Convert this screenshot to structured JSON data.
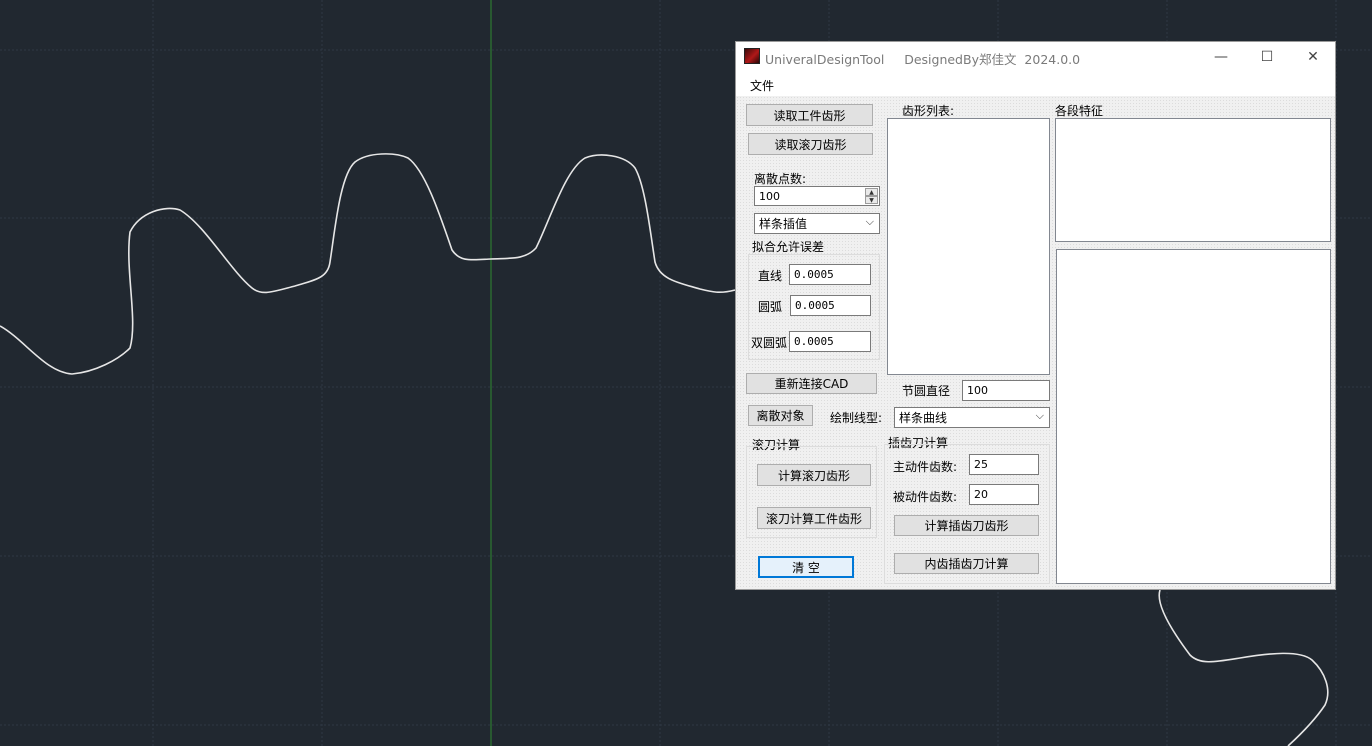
{
  "window": {
    "title": "UniveralDesignTool     DesignedBy郑佳文  2024.0.0",
    "minimize_glyph": "—",
    "maximize_glyph": "☐",
    "close_glyph": "✕"
  },
  "menu": {
    "file": "文件"
  },
  "left": {
    "read_workpiece_btn": "读取工件齿形",
    "read_hob_btn": "读取滚刀齿形",
    "discrete_points_label": "离散点数:",
    "discrete_points_value": "100",
    "interp_select": "样条插值",
    "fit_tolerance_title": "拟合允许误差",
    "line_label": "直线",
    "line_value": "0.0005",
    "arc_label": "圆弧",
    "arc_value": "0.0005",
    "double_arc_label": "双圆弧",
    "double_arc_value": "0.0005",
    "reconnect_btn": "重新连接CAD",
    "discrete_obj_btn": "离散对象",
    "hob_calc_title": "滚刀计算",
    "calc_hob_btn": "计算滚刀齿形",
    "hob_calc_workpiece_btn": "滚刀计算工件齿形",
    "clear_btn": "清 空"
  },
  "middle": {
    "tooth_list_label": "齿形列表:",
    "pitch_diameter_label": "节圆直径",
    "pitch_diameter_value": "100",
    "draw_linetype_label": "绘制线型:",
    "draw_linetype_select": "样条曲线",
    "shaper_calc_title": "插齿刀计算",
    "driver_teeth_label": "主动件齿数:",
    "driver_teeth_value": "25",
    "driven_teeth_label": "被动件齿数:",
    "driven_teeth_value": "20",
    "calc_shaper_btn": "计算插齿刀齿形",
    "internal_shaper_btn": "内齿插齿刀计算"
  },
  "right": {
    "segment_features_label": "各段特征"
  },
  "colors": {
    "cad_background": "#212830",
    "grid": "#2e3844",
    "axis": "#2f8a2f",
    "curve": "#e6e6e6",
    "focus_border": "#0078d7"
  }
}
